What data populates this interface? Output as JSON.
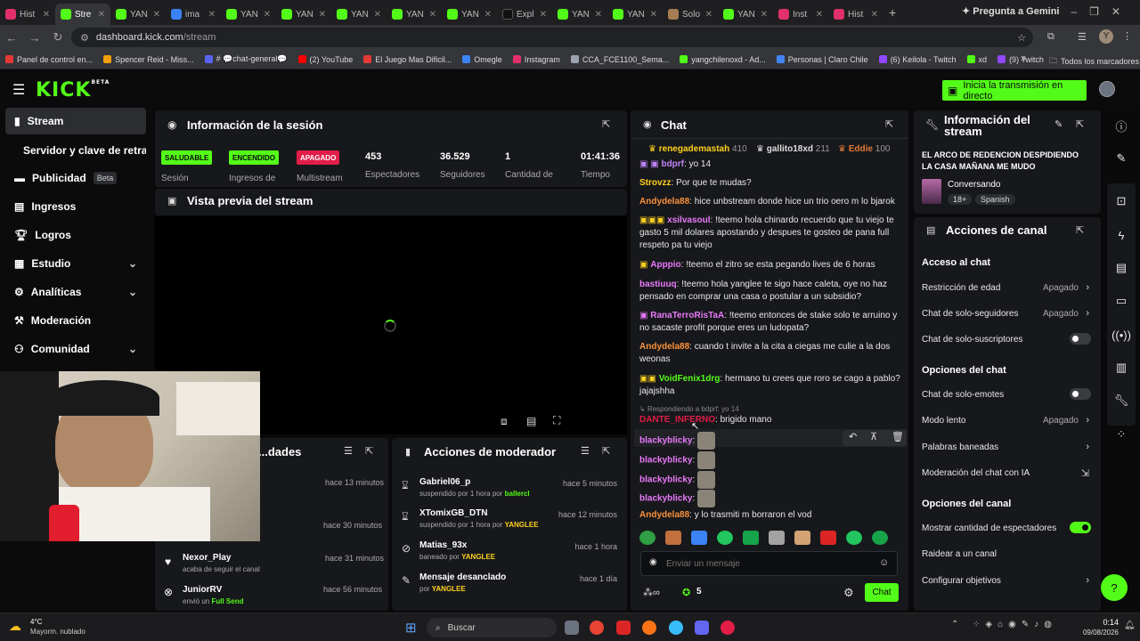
{
  "browser": {
    "tabs": [
      "Hist",
      "Stre",
      "YAN",
      "ima",
      "YAN",
      "YAN",
      "YAN",
      "YAN",
      "YAN",
      "Expl",
      "YAN",
      "YAN",
      "Solo",
      "YAN",
      "Inst",
      "Hist"
    ],
    "new_tab": "+",
    "gemini": "Pregunta a Gemini",
    "url_host": "dashboard.kick.com",
    "url_path": "/stream",
    "profile": "Y",
    "bookmarks": [
      "Panel de control en...",
      "Spencer Reid - Miss...",
      "# 💬chat-general💬",
      "(2) YouTube",
      "El Juego Mas Dificil...",
      "Omegle",
      "Instagram",
      "CCA_FCE1100_Sema...",
      "yangchilenoxd - Ad...",
      "Personas | Claro Chile",
      "(6) Keilola - Twitch",
      "xd",
      "(9) Twitch"
    ],
    "bookmarks_more": "»",
    "all_bookmarks": "Todos los marcadores"
  },
  "header": {
    "logo": "KICK",
    "logo_tag": "BETA",
    "go_live": "Inicia la transmisión en directo"
  },
  "sidebar": {
    "items": [
      {
        "label": "Stream"
      },
      {
        "label": "Servidor y clave de retransmisión"
      },
      {
        "label": "Publicidad",
        "badge": "Beta"
      },
      {
        "label": "Ingresos"
      },
      {
        "label": "Logros"
      },
      {
        "label": "Estudio"
      },
      {
        "label": "Analíticas"
      },
      {
        "label": "Moderación"
      },
      {
        "label": "Comunidad"
      }
    ]
  },
  "session": {
    "title": "Información de la sesión",
    "health": {
      "badge": "SALUDABLE",
      "label": "Sesión"
    },
    "revenue": {
      "badge": "ENCENDIDO",
      "label": "Ingresos de"
    },
    "multistream": {
      "badge": "APAGADO",
      "label": "Multistream"
    },
    "viewers": {
      "value": "453",
      "label": "Espectadores"
    },
    "followers": {
      "value": "36.529",
      "label": "Seguidores"
    },
    "count": {
      "value": "1",
      "label": "Cantidad de"
    },
    "time": {
      "value": "01:41:36",
      "label": "Tiempo"
    }
  },
  "preview": {
    "title": "Vista previa del stream"
  },
  "activity": {
    "title": "...dades",
    "rows": [
      {
        "time": "hace 13 minutos"
      },
      {
        "time": "hace 30 minutos"
      },
      {
        "user": "Nexor_Play",
        "desc": "acaba de seguir el canal",
        "time": "hace 31 minutos"
      },
      {
        "user": "JuniorRV",
        "desc": "envió un",
        "highlight": "Full Send",
        "time": "hace 56 minutos"
      }
    ]
  },
  "mod_actions": {
    "title": "Acciones de moderador",
    "rows": [
      {
        "user": "Gabriel06_p",
        "desc": "suspendido por 1 hora por",
        "by": "ballercl",
        "time": "hace 5 minutos"
      },
      {
        "user": "XTomixGB_DTN",
        "desc": "suspendido por 1 hora por",
        "by": "YANGLEE",
        "time": "hace 12 minutos"
      },
      {
        "user": "Matias_93x",
        "desc": "baneado por",
        "by": "YANGLEE",
        "time": "hace 1 hora"
      },
      {
        "user": "Mensaje desanclado",
        "desc": "por",
        "by": "YANGLEE",
        "time": "hace 1 día"
      }
    ]
  },
  "chat": {
    "title": "Chat",
    "top_gifters": [
      {
        "name": "renegademastah",
        "count": "410"
      },
      {
        "name": "gallito18xd",
        "count": "211"
      },
      {
        "name": "Eddie",
        "count": "100"
      }
    ],
    "messages": [
      {
        "user": "bdprf",
        "text": ": yo 14"
      },
      {
        "user": "Strovzz",
        "text": ": Por que te mudas?"
      },
      {
        "user": "Andydela88",
        "text": ": hice unbstream donde hice un trio oero m lo bjarok"
      },
      {
        "user": "xsilvasoul",
        "text": ": !teemo hola chinardo recuerdo que tu viejo te gasto 5 mil dolares apostando y despues te gosteo de pana full respeto pa tu viejo"
      },
      {
        "user": "Apppio",
        "text": ": !teemo el zitro se esta pegando lives de 6 horas"
      },
      {
        "user": "bastiuuq",
        "text": ": !teemo hola yanglee te sigo hace caleta, oye no haz pensado en comprar una casa o postular a un subsidio?"
      },
      {
        "user": "RanaTerroRisTaA",
        "text": ": !teemo entonces de stake solo te arruino y no sacaste profit porque eres un ludopata?"
      },
      {
        "user": "Andydela88",
        "text": ": cuando t invite a la cita a ciegas me culie a la dos weonas"
      },
      {
        "user": "VoidFenix1drg",
        "text": ": hermano tu crees que roro se cago a pablo? jajajshha"
      },
      {
        "reply": "Respondiendo a bdprf: yo 14",
        "user": "DANTE_INFERNO",
        "text": ": brigido mano"
      },
      {
        "user": "blackyblicky",
        "text": ":"
      },
      {
        "user": "blackyblicky",
        "text": ":"
      },
      {
        "user": "blackyblicky",
        "text": ":"
      },
      {
        "user": "blackyblicky",
        "text": ":"
      },
      {
        "user": "Andydela88",
        "text": ": y lo trasmiti m borraron el vod"
      }
    ],
    "input_placeholder": "Enviar un mensaje",
    "points": "5",
    "send": "Chat"
  },
  "stream_info": {
    "title": "Información del stream",
    "stream_title": "EL ARCO DE REDENCION DESPIDIENDO LA CASA MAÑANA ME MUDO",
    "category": "Conversando",
    "tags": [
      "18+",
      "Spanish"
    ]
  },
  "channel_actions": {
    "title": "Acciones de canal",
    "chat_access_heading": "Acceso al chat",
    "age": {
      "label": "Restricción de edad",
      "value": "Apagado"
    },
    "followers_only": {
      "label": "Chat de solo-seguidores",
      "value": "Apagado"
    },
    "subs_only": {
      "label": "Chat de solo-suscriptores"
    },
    "chat_options_heading": "Opciones del chat",
    "emotes_only": {
      "label": "Chat de solo-emotes"
    },
    "slow": {
      "label": "Modo lento",
      "value": "Apagado"
    },
    "banned_words": {
      "label": "Palabras baneadas"
    },
    "ai_mod": {
      "label": "Moderación del chat con IA"
    },
    "channel_options_heading": "Opciones del canal",
    "show_viewers": {
      "label": "Mostrar cantidad de espectadores"
    },
    "raid": {
      "label": "Raidear a un canal"
    },
    "goals": {
      "label": "Configurar objetivos"
    }
  },
  "taskbar": {
    "weather_temp": "4°C",
    "weather_desc": "Mayorm. nublado",
    "search": "Buscar",
    "time": "0:14",
    "date": "09/08/2026"
  },
  "colors": {
    "kick_green": "#53fc18",
    "panel": "#17181b",
    "background": "#0a0a0b"
  }
}
